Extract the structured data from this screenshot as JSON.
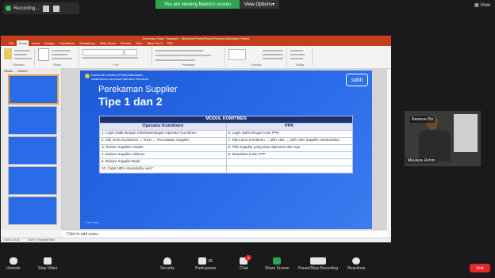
{
  "zoom": {
    "recording_label": "Recording...",
    "banner": "You are viewing Mamo's screen",
    "view_options": "View Options",
    "view_label": "View",
    "end_label": "End",
    "participant_name": "Maulana Rohim",
    "remove_pin": "Remove Pin",
    "participants_count": "38",
    "chat_badge": "1",
    "toolbar": {
      "unmute": "Unmute",
      "stop_video": "Stop Video",
      "security": "Security",
      "participants": "Participants",
      "chat": "Chat",
      "share_screen": "Share Screen",
      "pause_recording": "Pause/Stop Recording",
      "reactions": "Reactions"
    }
  },
  "ppt": {
    "title": "Summary Sdsu Transaksi - Microsoft PowerPoint (Product Activation Failed)",
    "tabs": [
      "File",
      "Home",
      "Insert",
      "Design",
      "Transitions",
      "Animations",
      "Slide Show",
      "Review",
      "View",
      "Nitro Pro 9",
      "PDF"
    ],
    "active_tab": "Home",
    "groups": [
      "Clipboard",
      "Slides",
      "Font",
      "Paragraph",
      "Drawing",
      "Editing"
    ],
    "pane_tabs": [
      "Slides",
      "Outline"
    ],
    "notes_placeholder": "Click to add notes",
    "status_left": "Slide 1 of 24",
    "status_theme": "SAKTI Template Baru"
  },
  "slide": {
    "logo_line1": "Direktorat Jenderal Perbendaharaan",
    "logo_line2": "KEMENTERIAN KEUANGAN REPUBLIK INDONESIA",
    "brand": "sakti",
    "title_line1": "Perekaman Supplier",
    "title_line2": "Tipe 1 dan 2",
    "table_header": "MODUL KOMITMEN",
    "col_left": "Operator Komitmen",
    "col_right": "PPK",
    "rows_left": [
      "1. Login Sakti dengan role/kewenangan Operator Komitmen",
      "2. Klik menu Komitmen → RUH → Pencatatan Supplier",
      "3. Rekam Supplier Header",
      "4. Rekam Supplier Address",
      "5. Rekam Supplier Bank",
      "10. Catat NRS otomatis/by user*"
    ],
    "rows_right": [
      "6. Login Sakti dengan User PPK",
      "7. Klik menu Komitmen → pilih ADK → pilih ADK Supplier Interkoneksi",
      "8. Pilih Supplier yang akan diproses ADK-nya",
      "9. Masukkan kode OTP",
      "",
      ""
    ],
    "footer": "© SETI 2020"
  },
  "colors": {
    "accent_red": "#c43e1c",
    "slide_blue": "#2a6be8",
    "zoom_green": "#2da44e",
    "end_red": "#e0292b"
  }
}
